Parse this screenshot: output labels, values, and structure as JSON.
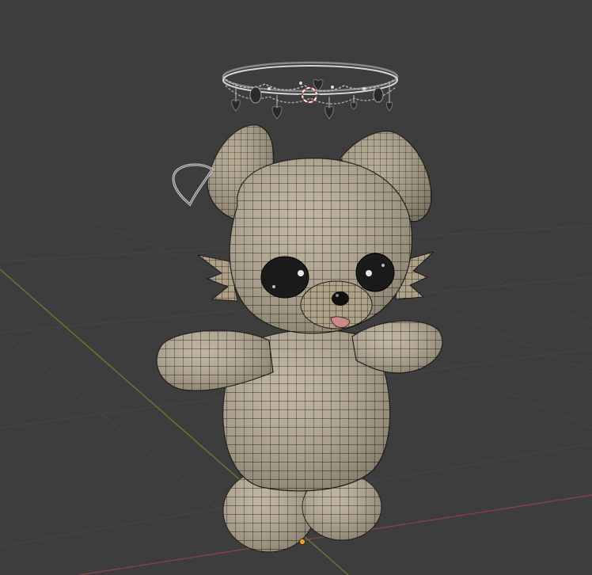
{
  "viewport": {
    "background_color": "#3d3d3d",
    "grid_color": "#464646",
    "x_axis_color": "#8a3e46",
    "y_axis_color": "#5f7f32"
  },
  "model": {
    "mesh_color": "#b8ab93",
    "wire_color": "#1d1b19",
    "eye_color": "#1a1a1a",
    "nose_color": "#111111",
    "tongue_color": "#c98a8a"
  },
  "halo": {
    "metal_color": "#c9c9c9",
    "charm_color": "#2a2a2a"
  },
  "selection": {
    "ring_color": "#e05050",
    "origin_color": "#f0a020"
  },
  "icons": {
    "object_origin": "origin-dot-icon",
    "3d_cursor": "3d-cursor-icon",
    "heart_hair_clip": "heart-clip-icon"
  }
}
